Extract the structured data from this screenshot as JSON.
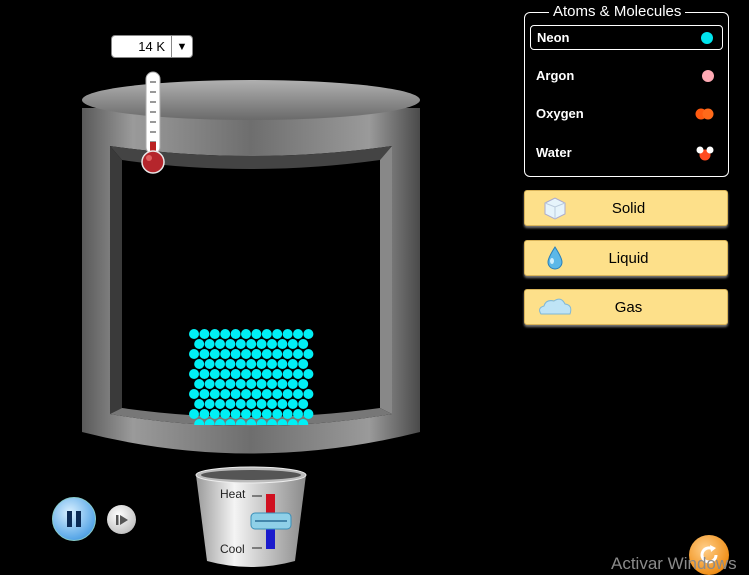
{
  "thermometer": {
    "temperature_label": "14 K"
  },
  "atoms_panel": {
    "title": "Atoms & Molecules",
    "items": [
      {
        "label": "Neon",
        "color": "#00e5ee",
        "selected": true
      },
      {
        "label": "Argon",
        "color": "#ffaab4",
        "selected": false
      },
      {
        "label": "Oxygen",
        "color": "#ff6a1a",
        "selected": false
      },
      {
        "label": "Water",
        "color": "#ff5a3a",
        "selected": false
      }
    ]
  },
  "phase_buttons": {
    "solid": "Solid",
    "liquid": "Liquid",
    "gas": "Gas"
  },
  "heater": {
    "heat_label": "Heat",
    "cool_label": "Cool"
  },
  "colors": {
    "particle": "#00f0f5",
    "button_bg": "#fde08a"
  },
  "watermark": "Activar Windows"
}
